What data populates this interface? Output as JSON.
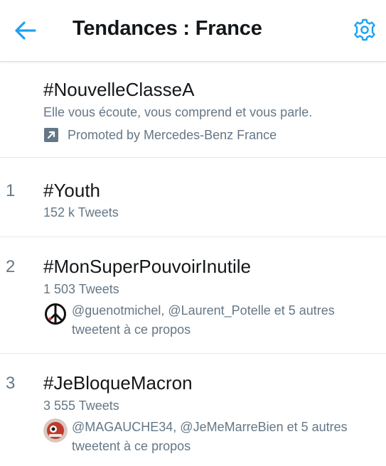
{
  "header": {
    "title": "Tendances : France",
    "accent_color": "#1da1f2",
    "back_icon": "arrow-left-icon",
    "settings_icon": "gear-icon"
  },
  "promoted": {
    "hashtag": "#NouvelleClasseA",
    "description": "Elle vous écoute, vous comprend et vous parle.",
    "promoted_by": "Promoted by Mercedes-Benz France",
    "promo_icon": "promoted-arrow-icon"
  },
  "trends": [
    {
      "rank": "1",
      "hashtag": "#Youth",
      "tweets": "152 k Tweets"
    },
    {
      "rank": "2",
      "hashtag": "#MonSuperPouvoirInutile",
      "tweets": "1 503 Tweets",
      "context_line1": "@guenotmichel, @Laurent_Potelle et 5 autres",
      "context_line2": "tweetent à ce propos",
      "avatar_icon": "peace-symbol-icon"
    },
    {
      "rank": "3",
      "hashtag": "#JeBloqueMacron",
      "tweets": "3 555 Tweets",
      "context_line1": "@MAGAUCHE34, @JeMeMarreBien et 5 autres",
      "context_line2": "tweetent à ce propos",
      "avatar_icon": "profile-avatar-icon"
    }
  ]
}
